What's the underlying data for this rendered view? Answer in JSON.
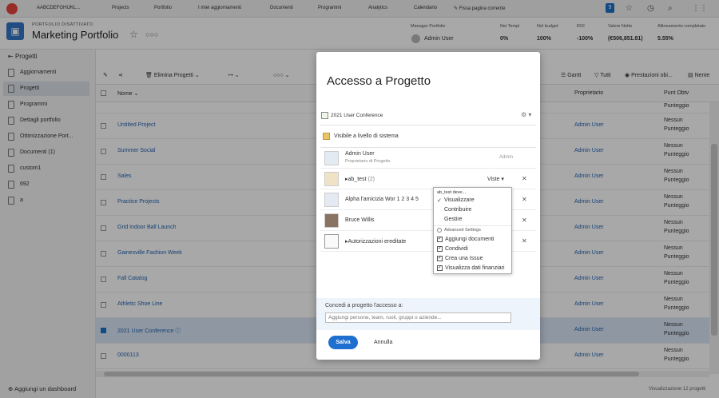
{
  "topnav": {
    "workspace": "AABCDEFGHIJKL...",
    "items": [
      "Projects",
      "Portfolio",
      "I miei aggiornamenti",
      "Documenti",
      "Programmi",
      "Analytics",
      "Calendario"
    ],
    "pin": "Fissa pagina corrente",
    "badge": "9"
  },
  "header": {
    "subtitle": "PORTFOLIO DISATTIVATO",
    "title": "Marketing Portfolio",
    "meta": [
      {
        "label": "Manager Portfolio",
        "value": "Admin User"
      },
      {
        "label": "Nei Tempi",
        "value": "0%"
      },
      {
        "label": "Nel budget",
        "value": "100%"
      },
      {
        "label": "ROI",
        "value": "-100%"
      },
      {
        "label": "Valore Netto",
        "value": "(€506,851.81)"
      },
      {
        "label": "Allineamento completato",
        "value": "5.55%"
      }
    ]
  },
  "sidebar": {
    "back": "Progetti",
    "items": [
      {
        "label": "Aggiornamenti"
      },
      {
        "label": "Progetti"
      },
      {
        "label": "Programmi"
      },
      {
        "label": "Dettagli portfolio"
      },
      {
        "label": "Ottimizzazione Port..."
      },
      {
        "label": "Documenti (1)"
      },
      {
        "label": "custom1"
      },
      {
        "label": "692"
      },
      {
        "label": "a"
      }
    ],
    "add_dashboard": "Aggiungi un dashboard"
  },
  "toolbar": {
    "delete": "Elimina Progetti",
    "gantt": "Gantt",
    "all": "Tutti",
    "performance": "Prestazioni obi...",
    "none": "Nente"
  },
  "table": {
    "headers": {
      "name": "Nome",
      "owner": "Proprietario",
      "points": "Punt Obtv"
    },
    "rows": [
      {
        "name": "Untitled Project",
        "owner": "Admin User",
        "p1": "Nessun",
        "p2": "Punteggio"
      },
      {
        "name": "Summer Social",
        "owner": "Admin User",
        "p1": "Nessun",
        "p2": "Punteggio"
      },
      {
        "name": "Sales",
        "owner": "Admin User",
        "p1": "Nessun",
        "p2": "Punteggio"
      },
      {
        "name": "Practice Projects",
        "owner": "Admin User",
        "p1": "Nessun",
        "p2": "Punteggio"
      },
      {
        "name": "Grid Indoor Ball Launch",
        "owner": "Admin User",
        "p1": "Nessun",
        "p2": "Punteggio"
      },
      {
        "name": "Gainesville Fashion Week",
        "owner": "Admin User",
        "p1": "Nessun",
        "p2": "Punteggio"
      },
      {
        "name": "Fall Catalog",
        "owner": "Admin User",
        "p1": "Nessun",
        "p2": "Punteggio"
      },
      {
        "name": "Athletic Shoe Line",
        "owner": "Admin User",
        "p1": "Nessun",
        "p2": "Punteggio"
      },
      {
        "name": "2021 User Conference",
        "owner": "Admin User",
        "p1": "Nessun",
        "p2": "Punteggio"
      },
      {
        "name": "0000113",
        "owner": "Admin User",
        "p1": "Nessun",
        "p2": "Punteggio"
      }
    ],
    "top_partial": {
      "p2": "Punteggio"
    },
    "count": "Visualizzazione 12 progetti"
  },
  "modal": {
    "title": "Accesso a Progetto",
    "project": "2021 User Conference",
    "visibility": "Visibile a livello di sistema",
    "members": [
      {
        "name": "Admin User",
        "sub": "Proprietario di Progetto",
        "role": "Admin"
      },
      {
        "name": "ab_test",
        "count": "(2)",
        "access": "Viste"
      },
      {
        "name": "Alpha l'amicizia Wor 1 2 3 4 5"
      },
      {
        "name": "Bruce Willis"
      },
      {
        "name": "Autorizzazioni ereditate"
      }
    ],
    "dropdown": {
      "header": "ab_test deve...",
      "options": [
        "Visualizzare",
        "Contribuire",
        "Gestire"
      ],
      "advanced": "Advanced Settings",
      "checkboxes": [
        "Aggiungi documenti",
        "Condividi",
        "Crea una Issue",
        "Visualizza dati finanziari"
      ]
    },
    "share_label": "Concedi a progetto l'accesso a:",
    "share_placeholder": "Aggiungi persone, team, ruoli, gruppi o aziende...",
    "save": "Salva",
    "cancel": "Annulla"
  }
}
